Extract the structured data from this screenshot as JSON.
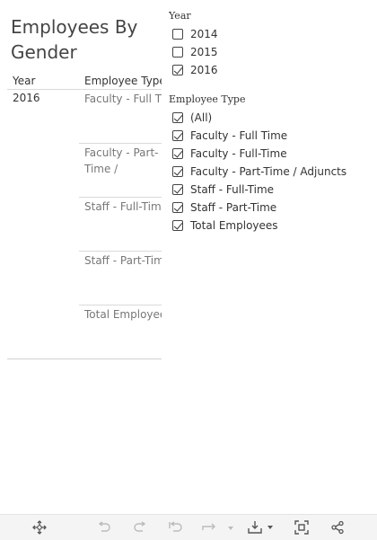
{
  "title": "Employees By Gender",
  "table": {
    "col_year": "Year",
    "col_type": "Employee Type",
    "year_value": "2016",
    "rows": [
      "Faculty - Full Time",
      "Faculty - Part-Time / Adjuncts",
      "Staff - Full-Time",
      "Staff - Part-Time",
      "Total Employees"
    ]
  },
  "filters": {
    "year": {
      "title": "Year",
      "options": [
        {
          "label": "2014",
          "checked": false
        },
        {
          "label": "2015",
          "checked": false
        },
        {
          "label": "2016",
          "checked": true
        }
      ]
    },
    "employee_type": {
      "title": "Employee Type",
      "options": [
        {
          "label": "(All)",
          "checked": true
        },
        {
          "label": "Faculty - Full Time",
          "checked": true
        },
        {
          "label": "Faculty - Full-Time",
          "checked": true
        },
        {
          "label": "Faculty - Part-Time / Adjuncts",
          "checked": true
        },
        {
          "label": "Staff - Full-Time",
          "checked": true
        },
        {
          "label": "Staff - Part-Time",
          "checked": true
        },
        {
          "label": "Total Employees",
          "checked": true
        }
      ]
    }
  },
  "toolbar": {
    "icons": [
      "move-icon",
      "undo-icon",
      "redo-icon",
      "revert-icon",
      "refresh-icon",
      "download-icon",
      "fullscreen-icon",
      "share-icon"
    ]
  },
  "colors": {
    "toolbar_bg": "#f4f4f4",
    "divider": "#d9d9d9",
    "muted_text": "#777777"
  }
}
